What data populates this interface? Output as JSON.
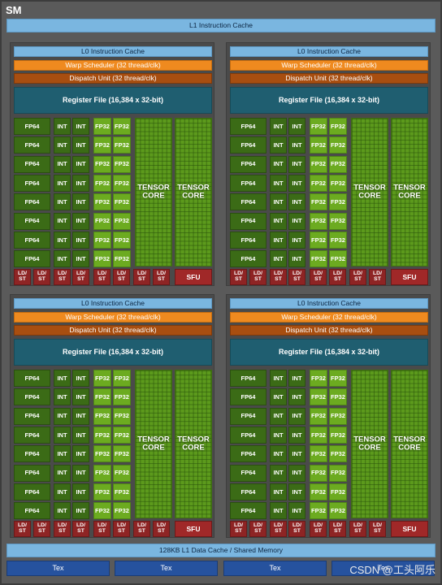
{
  "sm_title": "SM",
  "l1_instruction_cache": "L1 Instruction Cache",
  "l1_data_cache": "128KB L1 Data Cache / Shared Memory",
  "tex_units": [
    "Tex",
    "Tex",
    "Tex",
    "Tex"
  ],
  "processing_block": {
    "l0_cache": "L0 Instruction Cache",
    "warp_scheduler": "Warp Scheduler (32 thread/clk)",
    "dispatch_unit": "Dispatch Unit (32 thread/clk)",
    "register_file": "Register File (16,384 x 32-bit)",
    "fp64_label": "FP64",
    "int_label": "INT",
    "fp32_label": "FP32",
    "tensor_label_1": "TENSOR",
    "tensor_label_2": "CORE",
    "ldst_label_1": "LD/",
    "ldst_label_2": "ST",
    "sfu_label": "SFU"
  },
  "layout_counts": {
    "blocks": 4,
    "rows_per_block": 8,
    "tensor_cores_per_block": 2,
    "ldst_per_block": 6
  },
  "watermark": "CSDN @工头阿乐",
  "colors": {
    "frame": "#5a5a5a",
    "cache": "#7ab6e0",
    "warp_scheduler": "#ef8a1f",
    "dispatch": "#a84e10",
    "register_file": "#1f5e70",
    "fp64_int": "#3b6b16",
    "fp32": "#6cab20",
    "tensor": "#5c9a1c",
    "ldst_sfu": "#8e2424",
    "tex": "#26529e"
  }
}
